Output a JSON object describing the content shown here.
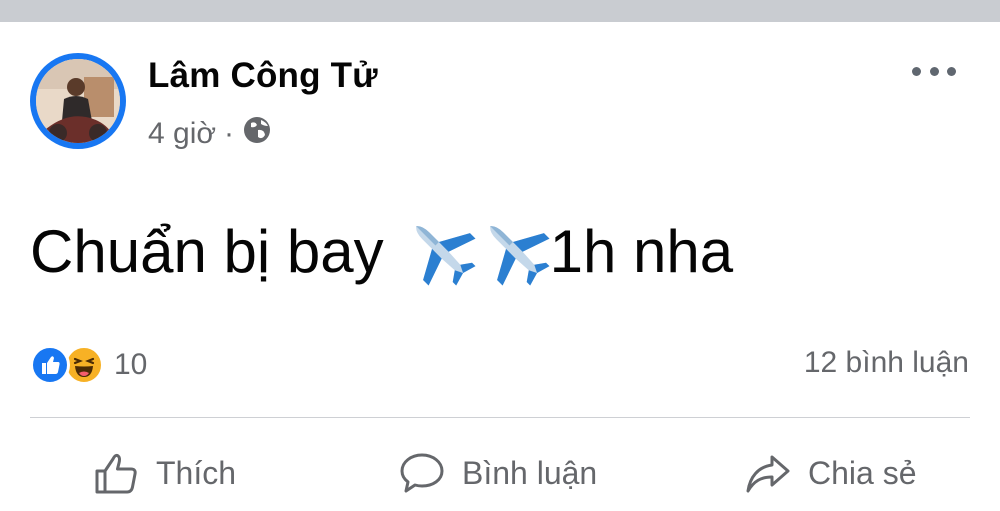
{
  "post": {
    "author": "Lâm Công Tử",
    "time": "4 giờ",
    "separator": "·",
    "privacy_icon": "globe-icon",
    "text": "Chuẩn bị bay",
    "text_suffix": "1h nha",
    "emojis": [
      "airplane-icon",
      "airplane-icon"
    ]
  },
  "reactions": {
    "icons": [
      "like-icon",
      "haha-icon"
    ],
    "count": "10",
    "comments": "12 bình luận"
  },
  "actions": {
    "like": "Thích",
    "comment": "Bình luận",
    "share": "Chia sẻ"
  },
  "colors": {
    "accent": "#1877f2",
    "secondary_text": "#65676b",
    "haha": "#f7b125",
    "topbar": "#c9ccd1"
  }
}
